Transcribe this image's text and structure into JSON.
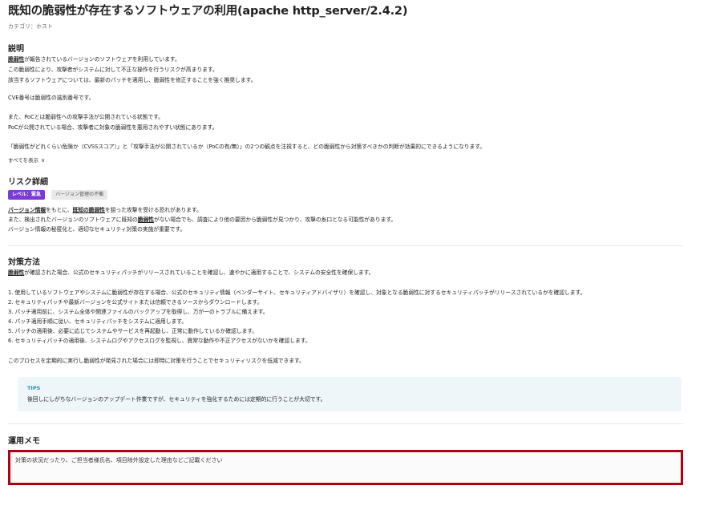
{
  "header": {
    "title": "既知の脆弱性が存在するソフトウェアの利用(apache http_server/2.4.2)",
    "category": "カテゴリ：ホスト"
  },
  "description": {
    "heading": "説明",
    "line1_term": "脆弱性",
    "line1_rest": "が報告されているバージョンのソフトウェアを利用しています。",
    "line2": "この脆弱性により、攻撃者がシステムに対して不正な操作を行うリスクが高まります。",
    "line3": "該当するソフトウェアについては、最新のパッチを適用し、脆弱性を修正することを強く推奨します。",
    "line4": "CVE番号は脆弱性の識別番号です。",
    "line5": "また、PoCとは脆弱性への攻撃手法が公開されている状態です。",
    "line6": "PoCが公開されている場合、攻撃者に対象の脆弱性を悪用されやすい状態にあります。",
    "line7": "「脆弱性がどれくらい危険か（CVSSスコア）」と「攻撃手法が公開されているか（PoCの有/無）」の2つの観点を注視すると、どの脆弱性から対策すべきかの判断が効果的にできるようになります。",
    "show_all": "すべてを表示",
    "show_all_icon": "chevron-down-icon"
  },
  "risk": {
    "heading": "リスク詳細",
    "level_badge": "レベル：緊急",
    "tag_badge": "バージョン管理の不備",
    "line1_term1": "バージョン情報",
    "line1_mid": "をもとに、",
    "line1_term2": "既知の脆弱性",
    "line1_rest": "を狙った攻撃を受ける恐れがあります。",
    "line2_pre": "また、検出されたバージョンのソフトウェアに既知の",
    "line2_term": "脆弱性",
    "line2_rest": "がない場合でも、調査により他の要因から脆弱性が見つかり、攻撃の糸口となる可能性があります。",
    "line3": "バージョン情報の秘匿化と、適切なセキュリティ対策の実施が重要です。",
    "colors": {
      "level_badge_bg": "#7a3bd6",
      "tag_badge_bg": "#e8e8e8"
    }
  },
  "countermeasure": {
    "heading": "対策方法",
    "intro_term": "脆弱性",
    "intro_rest": "が確認された場合、公式のセキュリティパッチがリリースされていることを確認し、速やかに適用することで、システムの安全性を確保します。",
    "steps": [
      "1. 使用しているソフトウェアやシステムに脆弱性が存在する場合、公式のセキュリティ情報（ベンダーサイト、セキュリティアドバイザリ）を確認し、対象となる脆弱性に対するセキュリティパッチがリリースされているかを確認します。",
      "2. セキュリティパッチや最新バージョンを公式サイトまたは信頼できるソースからダウンロードします。",
      "3. パッチ適用前に、システム全体や関連ファイルのバックアップを取得し、万が一のトラブルに備えます。",
      "4. パッチ適用手順に従い、セキュリティパッチをシステムに適用します。",
      "5. パッチの適用後、必要に応じてシステムやサービスを再起動し、正常に動作しているか確認します。",
      "6. セキュリティパッチの適用後、システムログやアクセスログを監視し、異常な動作や不正アクセスがないかを確認します。"
    ],
    "closing": "このプロセスを定期的に実行し脆弱性が発見された場合には即時に対策を行うことでセキュリティリスクを低減できます。",
    "tips_label": "TIPS",
    "tips_text": "後回しにしがちなバージョンのアップデート作業ですが、セキュリティを強化するためには定期的に行うことが大切です。",
    "colors": {
      "tips_bg": "#eef6fa",
      "tips_label": "#1f8fbf"
    }
  },
  "memo": {
    "heading": "運用メモ",
    "placeholder": "対策の状況だったり、ご担当者様氏名、項目除外設定した理由などご記載ください",
    "value": "",
    "highlight_color": "#b00012"
  }
}
